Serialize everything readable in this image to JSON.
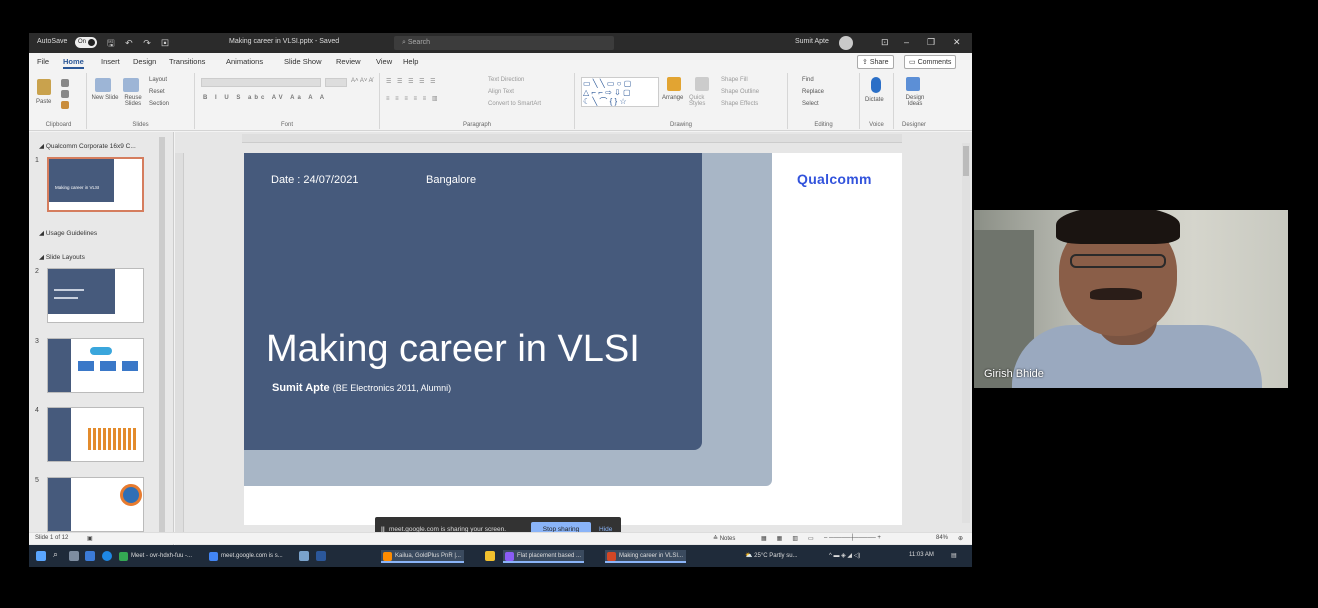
{
  "titlebar": {
    "autosave_label": "AutoSave",
    "autosave_state": "On",
    "file_name": "Making career in VLSI.pptx - Saved",
    "search_placeholder": "Search",
    "user_name": "Sumit Apte"
  },
  "tabs": [
    "File",
    "Home",
    "Insert",
    "Design",
    "Transitions",
    "Animations",
    "Slide Show",
    "Review",
    "View",
    "Help"
  ],
  "active_tab": "Home",
  "share_label": "Share",
  "comments_label": "Comments",
  "ribbon": {
    "groups": [
      "Clipboard",
      "Slides",
      "Font",
      "Paragraph",
      "Drawing",
      "Editing",
      "Voice",
      "Designer"
    ],
    "paste": "Paste",
    "new_slide": "New Slide",
    "reuse_slides": "Reuse Slides",
    "layout": "Layout",
    "reset": "Reset",
    "section": "Section",
    "text_direction": "Text Direction",
    "align_text": "Align Text",
    "convert_smartart": "Convert to SmartArt",
    "arrange": "Arrange",
    "quick_styles": "Quick Styles",
    "shape_fill": "Shape Fill",
    "shape_outline": "Shape Outline",
    "shape_effects": "Shape Effects",
    "find": "Find",
    "replace": "Replace",
    "select": "Select",
    "dictate": "Dictate",
    "design_ideas": "Design Ideas"
  },
  "thumbs": {
    "section1": "Qualcomm Corporate 16x9 C...",
    "section2": "Usage Guidelines",
    "section3": "Slide Layouts",
    "slide1_title": "Making career in VLSI",
    "slides": [
      "1",
      "2",
      "3",
      "4",
      "5"
    ]
  },
  "slide": {
    "date": "Date : 24/07/2021",
    "place": "Bangalore",
    "logo": "Qualcomm",
    "title": "Making career in VLSI",
    "presenter": "Sumit Apte",
    "presenter_note": "(BE Electronics 2011, Alumni)"
  },
  "sharebar": {
    "pause": "||",
    "message": "meet.google.com is sharing your screen.",
    "stop": "Stop sharing",
    "hide": "Hide"
  },
  "status": {
    "slide_count": "Slide 1 of 12",
    "notes": "Notes",
    "zoom": "84%"
  },
  "taskbar": {
    "items": [
      "Meet - ovr-hdxh-fuu -...",
      "meet.google.com is s...",
      "Kailua, GoldPlus PnR |...",
      "Flat placement based ...",
      "Making career in VLSI..."
    ],
    "weather": "25°C Partly su...",
    "time": "11:03 AM"
  },
  "cam": {
    "name": "Girish Bhide"
  },
  "colors": {
    "slide_navy": "#465a7c",
    "slide_light": "#a8b6c6",
    "qualcomm_blue": "#3253dc",
    "stop_button": "#8ab4f8"
  }
}
